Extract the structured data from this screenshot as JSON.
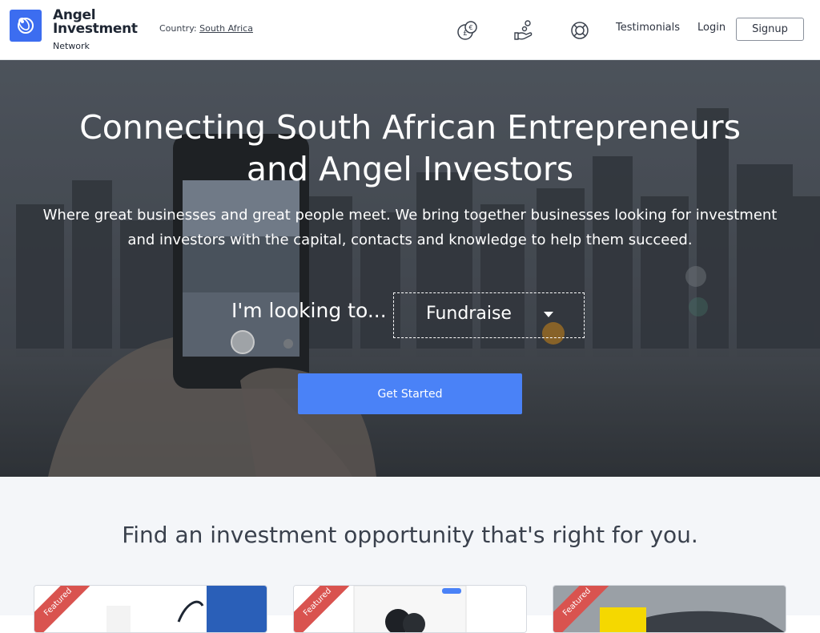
{
  "header": {
    "logo_title_line1": "Angel",
    "logo_title_line2": "Investment",
    "logo_sub": "Network",
    "country_label": "Country:",
    "country_value": "South Africa",
    "nav": {
      "testimonials": "Testimonials",
      "login": "Login",
      "signup": "Signup"
    },
    "icons": [
      "currency-icon",
      "invest-hand-icon",
      "help-lifebuoy-icon"
    ]
  },
  "hero": {
    "title_line1": "Connecting South African Entrepreneurs",
    "title_line2": "and Angel Investors",
    "subtitle_line1": "Where great businesses and great people meet. We bring together businesses looking for investment",
    "subtitle_line2": "and investors with the capital, contacts and knowledge to help them succeed.",
    "looking_label": "I'm looking to...",
    "select_value": "Fundraise",
    "cta_label": "Get Started"
  },
  "section": {
    "title": "Find an investment opportunity that's right for you.",
    "cards": [
      {
        "ribbon": "Featured"
      },
      {
        "ribbon": "Featured"
      },
      {
        "ribbon": "Featured"
      }
    ]
  },
  "colors": {
    "brand_blue": "#3c6df0",
    "cta_blue": "#4a82f7",
    "ribbon_red": "#d9534f"
  }
}
